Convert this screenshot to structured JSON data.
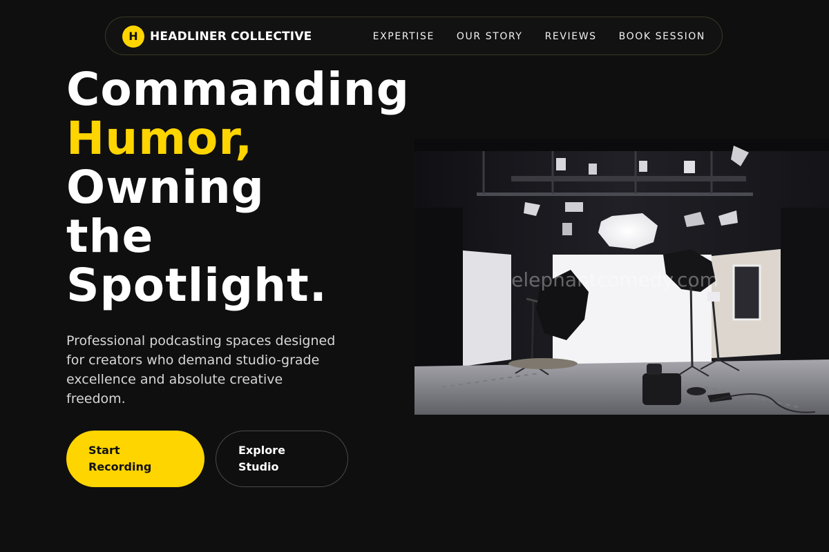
{
  "nav": {
    "logo_letter": "H",
    "brand": "HEADLINER COLLECTIVE",
    "links": [
      "EXPERTISE",
      "OUR STORY",
      "REVIEWS",
      "BOOK SESSION"
    ]
  },
  "hero": {
    "headline": {
      "line1": "Commanding",
      "line2": "Humor,",
      "line3": "Owning",
      "line4": "the",
      "line5": "Spotlight."
    },
    "description": "Professional podcasting spaces designed for creators who demand studio-grade excellence and absolute creative freedom.",
    "primary_cta": "Start Recording",
    "secondary_cta": "Explore Studio",
    "image_watermark": "elephantcomedy.com"
  },
  "colors": {
    "accent": "#ffd500",
    "background": "#0f0f10"
  }
}
